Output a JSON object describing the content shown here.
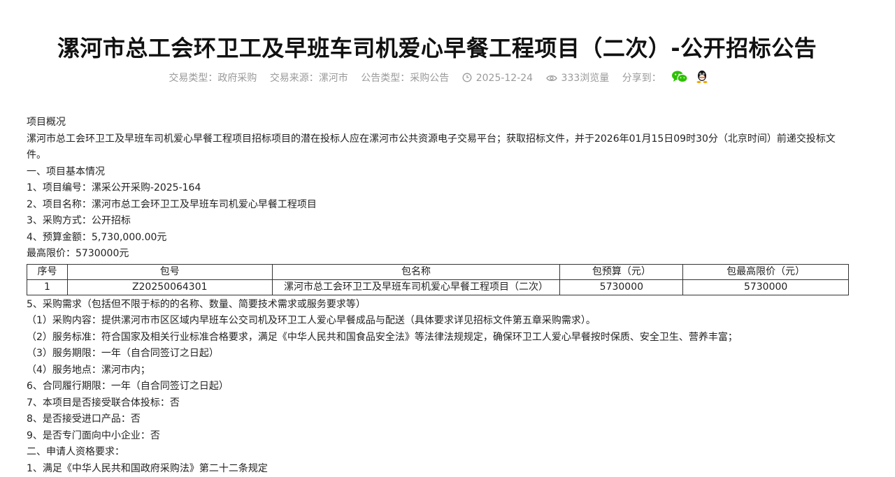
{
  "title": "漯河市总工会环卫工及早班车司机爱心早餐工程项目（二次）-公开招标公告",
  "meta": {
    "trade_type": "交易类型：政府采购",
    "trade_source": "交易来源：漯河市",
    "notice_type": "公告类型：采购公告",
    "date": "2025-12-24",
    "views": "333浏览量",
    "share": "分享到："
  },
  "icons": {
    "clock": "clock-icon",
    "eye": "eye-icon",
    "wechat": "wechat-icon",
    "qq": "qq-icon"
  },
  "colors": {
    "wechat": "#2dc100",
    "meta": "#9a9a9a"
  },
  "body": {
    "overview_heading": "项目概况",
    "overview_text": "漯河市总工会环卫工及早班车司机爱心早餐工程项目招标项目的潜在投标人应在漯河市公共资源电子交易平台；获取招标文件，并于2026年01月15日09时30分（北京时间）前递交投标文件。",
    "sec1_heading": "一、项目基本情况",
    "item1": "1、项目编号：漯采公开采购-2025-164",
    "item2": "2、项目名称：漯河市总工会环卫工及早班车司机爱心早餐工程项目",
    "item3": "3、采购方式：公开招标",
    "item4": "4、预算金额：5,730,000.00元",
    "max_price": "最高限价：5730000元",
    "item5": "5、采购需求（包括但不限于标的的名称、数量、简要技术需求或服务要求等）",
    "req1": "（1）采购内容：提供漯河市市区区域内早班车公交司机及环卫工人爱心早餐成品与配送（具体要求详见招标文件第五章采购需求）。",
    "req2": "（2）服务标准：符合国家及相关行业标准合格要求，满足《中华人民共和国食品安全法》等法律法规规定，确保环卫工人爱心早餐按时保质、安全卫生、营养丰富；",
    "req3": "（3）服务期限：一年（自合同签订之日起）",
    "req4": "（4）服务地点：漯河市内；",
    "item6": "6、合同履行期限：一年（自合同签订之日起）",
    "item7": "7、本项目是否接受联合体投标：否",
    "item8": "8、是否接受进口产品：否",
    "item9": "9、是否专门面向中小企业：否",
    "sec2_heading": "二、申请人资格要求：",
    "sec2_item1": "1、满足《中华人民共和国政府采购法》第二十二条规定"
  },
  "table": {
    "headers": [
      "序号",
      "包号",
      "包名称",
      "包预算（元）",
      "包最高限价（元）"
    ],
    "rows": [
      [
        "1",
        "Z20250064301",
        "漯河市总工会环卫工及早班车司机爱心早餐工程项目（二次）",
        "5730000",
        "5730000"
      ]
    ]
  }
}
